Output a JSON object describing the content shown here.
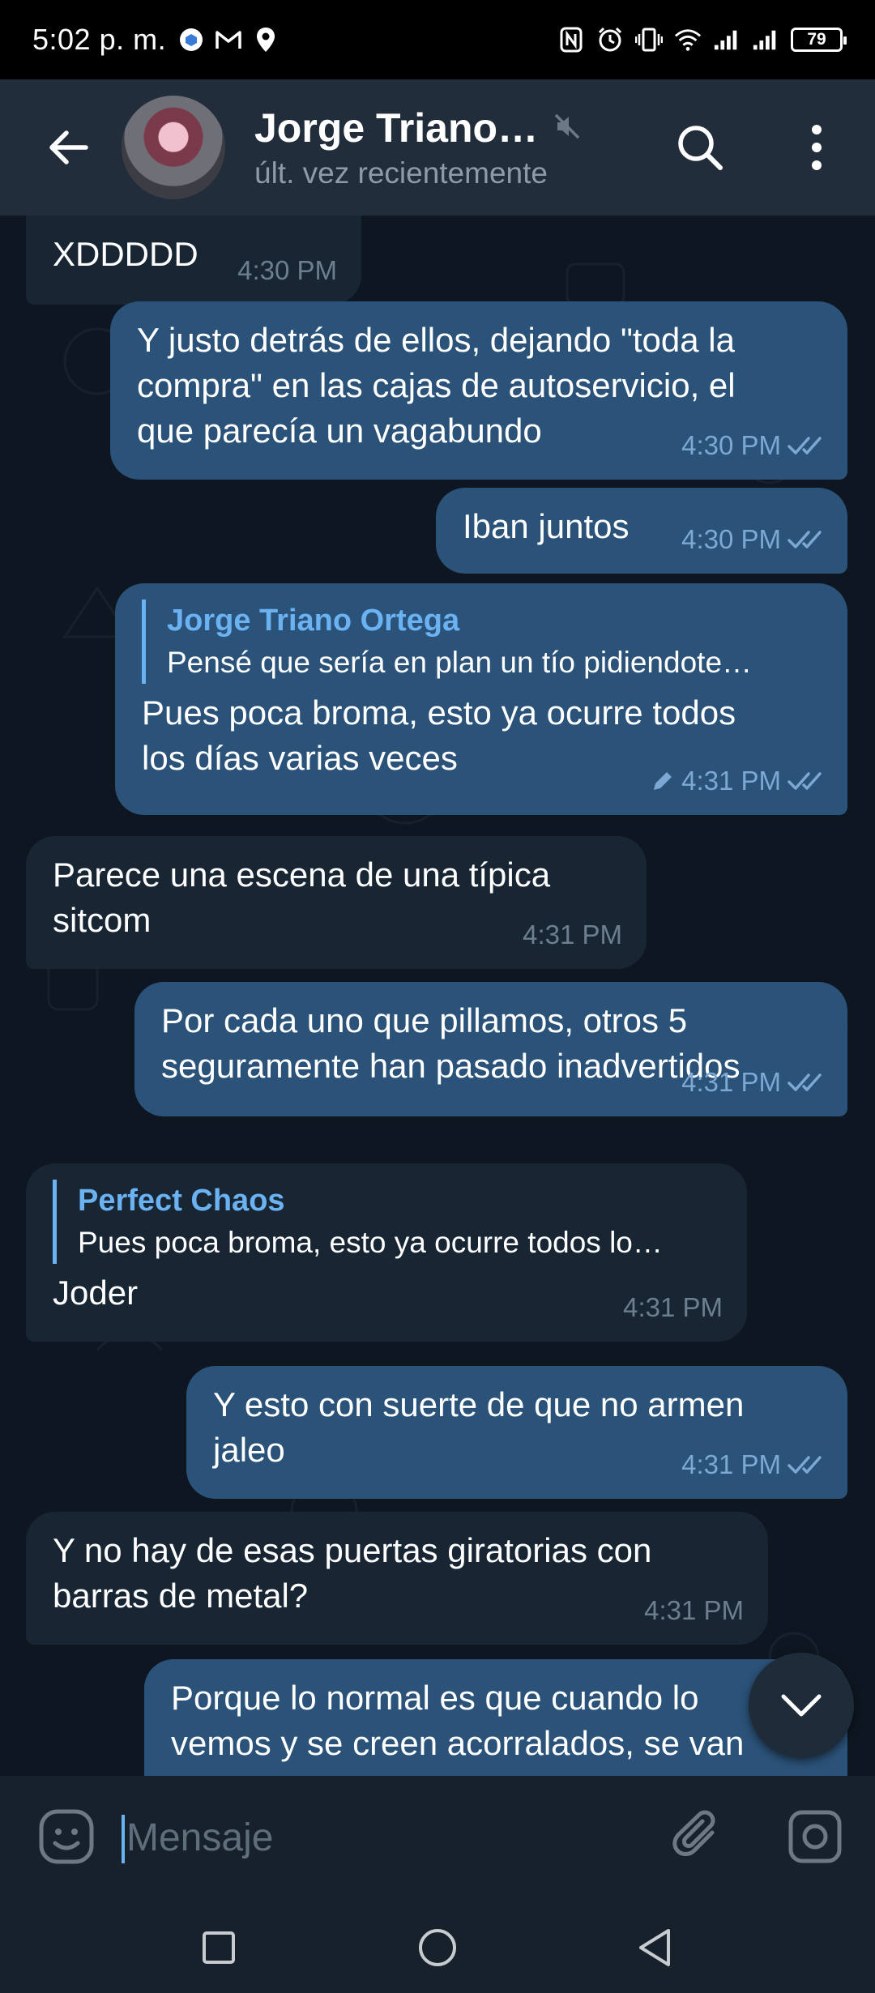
{
  "status_bar": {
    "time": "5:02 p. m.",
    "battery": "79",
    "icons": [
      "vpn-icon",
      "gmail-icon",
      "location-icon",
      "nfc-icon",
      "alarm-icon",
      "vibrate-icon",
      "wifi-icon",
      "signal-icon",
      "signal-icon"
    ]
  },
  "header": {
    "title": "Jorge Triano…",
    "subtitle": "últ. vez recientemente",
    "icons": [
      "back-arrow-icon",
      "muted-icon",
      "search-icon",
      "more-vert-icon"
    ]
  },
  "messages": [
    {
      "direction": "in",
      "lines": [
        "XDDDDD"
      ],
      "time": "4:30 PM"
    },
    {
      "direction": "out",
      "lines": [
        "Y justo detrás de ellos, dejando \"toda la",
        "compra\" en las cajas de autoservicio, el",
        "que parecía un vagabundo"
      ],
      "time": "4:30 PM",
      "read": true
    },
    {
      "direction": "out",
      "lines": [
        "Iban juntos"
      ],
      "time": "4:30 PM",
      "read": true
    },
    {
      "direction": "out",
      "reply": {
        "name": "Jorge Triano Ortega",
        "text": "Pensé que sería en plan un tío pidiendote…"
      },
      "lines": [
        "Pues poca broma, esto ya ocurre todos",
        "los días varias veces"
      ],
      "time": "4:31 PM",
      "edited": true,
      "read": true
    },
    {
      "direction": "in",
      "lines": [
        "Parece una escena de una típica",
        "sitcom"
      ],
      "time": "4:31 PM"
    },
    {
      "direction": "out",
      "lines": [
        "Por cada uno que pillamos, otros 5",
        "seguramente han pasado inadvertidos"
      ],
      "time": "4:31 PM",
      "read": true
    },
    {
      "direction": "in",
      "reply": {
        "name": "Perfect Chaos",
        "text": "Pues poca broma, esto ya ocurre todos lo…"
      },
      "lines": [
        "Joder"
      ],
      "time": "4:31 PM"
    },
    {
      "direction": "out",
      "lines": [
        "Y esto con suerte de que no armen",
        "jaleo"
      ],
      "time": "4:31 PM",
      "read": true
    },
    {
      "direction": "in",
      "lines": [
        "Y no hay de esas puertas giratorias con",
        "barras de metal?"
      ],
      "time": "4:31 PM"
    },
    {
      "direction": "out",
      "lines": [
        "Porque lo normal es que cuando lo",
        "vemos y se creen acorralados, se van"
      ],
      "time": ""
    }
  ],
  "input": {
    "placeholder": "Mensaje",
    "value": ""
  },
  "colors": {
    "header_bg": "#212d3b",
    "chat_bg": "#0e1621",
    "incoming_bubble": "#182533",
    "outgoing_bubble": "#2b5278",
    "accent": "#6ab2f2"
  }
}
